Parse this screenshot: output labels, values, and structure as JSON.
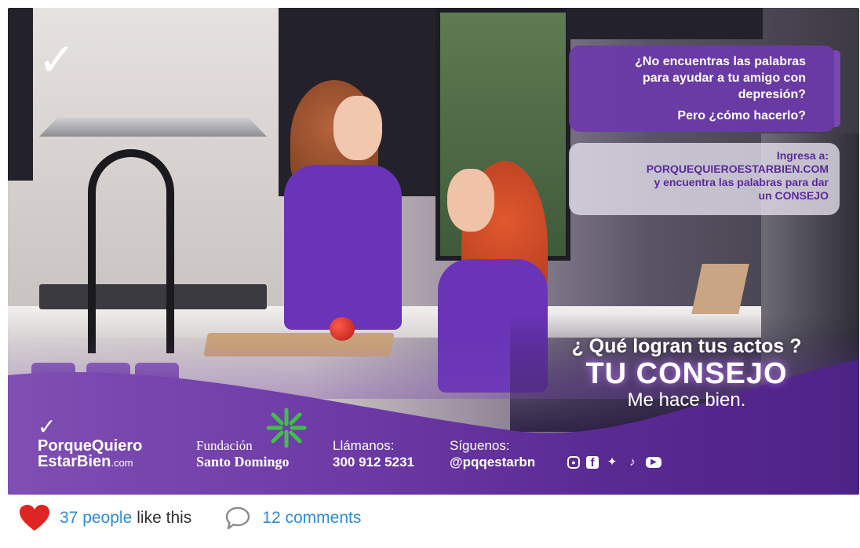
{
  "ad": {
    "bubble_question": {
      "lines": [
        "¿No encuentras las palabras",
        "para ayudar a tu amigo con",
        "depresión?"
      ],
      "followup": "Pero ¿cómo hacerlo?"
    },
    "bubble_info": {
      "lines": [
        "Ingresa a:",
        "PORQUEQUIEROESTARBIEN.COM",
        "y encuentra las palabras para dar",
        "un CONSEJO"
      ]
    },
    "headline": {
      "question": "¿ Qué logran tus actos ?",
      "main": "TU CONSEJO",
      "sub": "Me hace bien."
    },
    "brand": {
      "line1": "PorqueQuiero",
      "line2": "EstarBien",
      "suffix": ".com"
    },
    "foundation": {
      "line1": "Fundación",
      "line2": "Santo Domingo"
    },
    "contact": {
      "call_label": "Llámanos:",
      "phone": "300 912 5231",
      "follow_label": "Síguenos:",
      "handle": "@pqqestarbn"
    },
    "social_icons": [
      "instagram-icon",
      "facebook-icon",
      "twitter-icon",
      "tiktok-icon",
      "youtube-icon"
    ],
    "colors": {
      "purple": "#6d3aa6",
      "bubble_text_light": "#5b2a9a"
    }
  },
  "footer": {
    "likes_count": "37 people",
    "likes_text": "like this",
    "comments": "12 comments",
    "heart_color": "#e02424",
    "link_color": "#2e8bd6"
  }
}
